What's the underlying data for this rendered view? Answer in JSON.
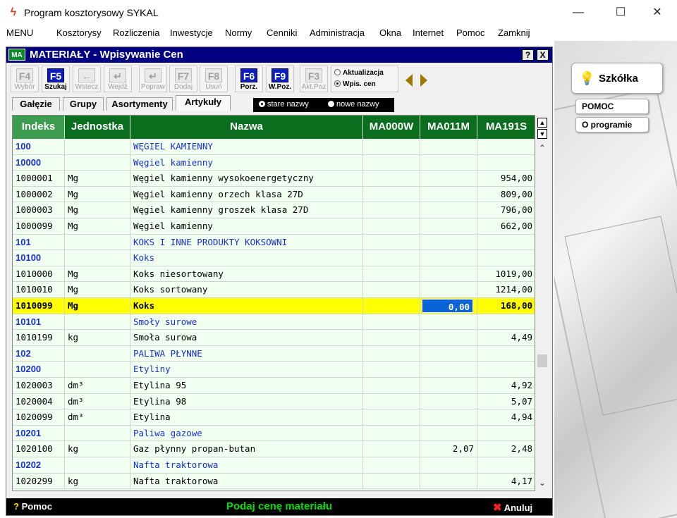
{
  "window": {
    "title": "Program kosztorysowy SYKAL",
    "minimize": "—",
    "maximize": "☐",
    "close": "✕"
  },
  "menu": [
    "MENU",
    "Kosztorysy",
    "Rozliczenia",
    "Inwestycje",
    "Normy",
    "Cenniki",
    "Administracja",
    "Okna",
    "Internet",
    "Pomoc",
    "Zamknij"
  ],
  "mdi": {
    "icon": "MA",
    "title": "MATERIAŁY - Wpisywanie Cen",
    "help_btn": "?",
    "close_btn": "X"
  },
  "toolbar": {
    "buttons": [
      {
        "key": "F4",
        "label": "Wybór",
        "active": false
      },
      {
        "key": "F5",
        "label": "Szukaj",
        "active": true
      },
      {
        "key": "←",
        "label": "Wstecz",
        "active": false
      },
      {
        "key": "↵",
        "label": "Wejdź",
        "active": false
      },
      {
        "key": "↵",
        "label": "Popraw",
        "active": false
      },
      {
        "key": "F7",
        "label": "Dodaj",
        "active": false
      },
      {
        "key": "F8",
        "label": "Usuń",
        "active": false
      },
      {
        "key": "F6",
        "label": "Porz.",
        "active": true
      },
      {
        "key": "F9",
        "label": "W.Poz.",
        "active": true
      },
      {
        "key": "F3",
        "label": "Akt.Poz",
        "active": false
      }
    ],
    "mode_options": [
      {
        "label": "Aktualizacja",
        "selected": false
      },
      {
        "label": "Wpis. cen",
        "selected": true
      }
    ]
  },
  "tabs": [
    {
      "label": "Gałęzie",
      "active": false
    },
    {
      "label": "Grupy",
      "active": false
    },
    {
      "label": "Asortymenty",
      "active": false
    },
    {
      "label": "Artykuły",
      "active": true
    }
  ],
  "name_mode": {
    "options": [
      {
        "label": "stare nazwy",
        "selected": true
      },
      {
        "label": "nowe nazwy",
        "selected": false
      }
    ]
  },
  "grid": {
    "columns": [
      "Indeks",
      "Jednostka",
      "Nazwa",
      "MA000W",
      "MA011M",
      "MA191S"
    ],
    "rows": [
      {
        "indeks": "100",
        "jm": "",
        "nazwa": "WĘGIEL KAMIENNY",
        "ma000w": "",
        "ma011m": "",
        "ma191s": "",
        "type": "group"
      },
      {
        "indeks": "10000",
        "jm": "",
        "nazwa": "Węgiel kamienny",
        "ma000w": "",
        "ma011m": "",
        "ma191s": "",
        "type": "group"
      },
      {
        "indeks": "1000001",
        "jm": "Mg",
        "nazwa": "Węgiel kamienny wysokoenergetyczny",
        "ma000w": "",
        "ma011m": "",
        "ma191s": "954,00",
        "type": "item"
      },
      {
        "indeks": "1000002",
        "jm": "Mg",
        "nazwa": "Węgiel kamienny orzech klasa 27D",
        "ma000w": "",
        "ma011m": "",
        "ma191s": "809,00",
        "type": "item"
      },
      {
        "indeks": "1000003",
        "jm": "Mg",
        "nazwa": "Węgiel kamienny groszek klasa 27D",
        "ma000w": "",
        "ma011m": "",
        "ma191s": "796,00",
        "type": "item"
      },
      {
        "indeks": "1000099",
        "jm": "Mg",
        "nazwa": "Węgiel kamienny",
        "ma000w": "",
        "ma011m": "",
        "ma191s": "662,00",
        "type": "item"
      },
      {
        "indeks": "101",
        "jm": "",
        "nazwa": "KOKS I INNE PRODUKTY KOKSOWNI",
        "ma000w": "",
        "ma011m": "",
        "ma191s": "",
        "type": "group"
      },
      {
        "indeks": "10100",
        "jm": "",
        "nazwa": "Koks",
        "ma000w": "",
        "ma011m": "",
        "ma191s": "",
        "type": "group"
      },
      {
        "indeks": "1010000",
        "jm": "Mg",
        "nazwa": "Koks niesortowany",
        "ma000w": "",
        "ma011m": "",
        "ma191s": "1019,00",
        "type": "item"
      },
      {
        "indeks": "1010010",
        "jm": "Mg",
        "nazwa": "Koks sortowany",
        "ma000w": "",
        "ma011m": "",
        "ma191s": "1214,00",
        "type": "item"
      },
      {
        "indeks": "1010099",
        "jm": "Mg",
        "nazwa": "Koks",
        "ma000w": "",
        "ma011m": "0,00",
        "ma191s": "168,00",
        "type": "selected"
      },
      {
        "indeks": "10101",
        "jm": "",
        "nazwa": "Smoły surowe",
        "ma000w": "",
        "ma011m": "",
        "ma191s": "",
        "type": "group"
      },
      {
        "indeks": "1010199",
        "jm": "kg",
        "nazwa": "Smoła surowa",
        "ma000w": "",
        "ma011m": "",
        "ma191s": "4,49",
        "type": "item"
      },
      {
        "indeks": "102",
        "jm": "",
        "nazwa": "PALIWA PŁYNNE",
        "ma000w": "",
        "ma011m": "",
        "ma191s": "",
        "type": "group"
      },
      {
        "indeks": "10200",
        "jm": "",
        "nazwa": "Etyliny",
        "ma000w": "",
        "ma011m": "",
        "ma191s": "",
        "type": "group"
      },
      {
        "indeks": "1020003",
        "jm": "dm³",
        "nazwa": "Etylina 95",
        "ma000w": "",
        "ma011m": "",
        "ma191s": "4,92",
        "type": "item"
      },
      {
        "indeks": "1020004",
        "jm": "dm³",
        "nazwa": "Etylina 98",
        "ma000w": "",
        "ma011m": "",
        "ma191s": "5,07",
        "type": "item"
      },
      {
        "indeks": "1020099",
        "jm": "dm³",
        "nazwa": "Etylina",
        "ma000w": "",
        "ma011m": "",
        "ma191s": "4,94",
        "type": "item"
      },
      {
        "indeks": "10201",
        "jm": "",
        "nazwa": "Paliwa gazowe",
        "ma000w": "",
        "ma011m": "",
        "ma191s": "",
        "type": "group"
      },
      {
        "indeks": "1020100",
        "jm": "kg",
        "nazwa": "Gaz płynny propan-butan",
        "ma000w": "",
        "ma011m": "2,07",
        "ma191s": "2,48",
        "type": "item"
      },
      {
        "indeks": "10202",
        "jm": "",
        "nazwa": "Nafta traktorowa",
        "ma000w": "",
        "ma011m": "",
        "ma191s": "",
        "type": "group"
      },
      {
        "indeks": "1020299",
        "jm": "kg",
        "nazwa": "Nafta traktorowa",
        "ma000w": "",
        "ma011m": "",
        "ma191s": "4,17",
        "type": "item"
      }
    ]
  },
  "status": {
    "help_q": "?",
    "help": "Pomoc",
    "message": "Podaj cenę materiału",
    "cancel_x": "✖",
    "cancel": "Anuluj"
  },
  "side": {
    "szkolka": "Szkółka",
    "pomoc": "POMOC",
    "o_programie": "O programie"
  },
  "colors": {
    "title_bar": "#000080",
    "header_green": "#0a6e1e",
    "selected_row": "#ffff00",
    "edit_cell": "#0a64d8",
    "group_text": "#1a2fd0",
    "status_msg": "#00e000"
  }
}
